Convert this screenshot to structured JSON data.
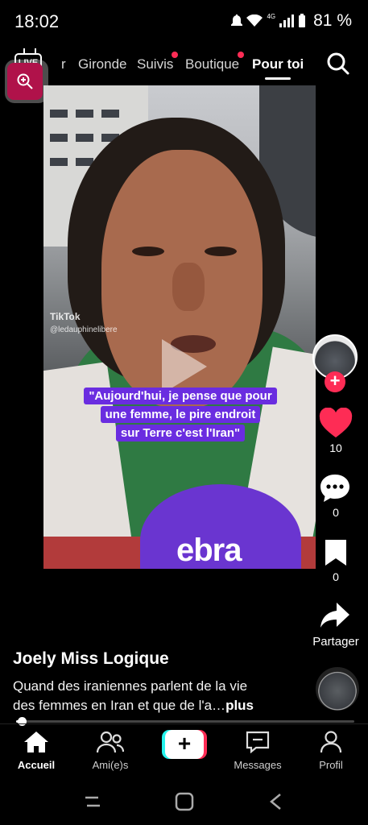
{
  "status_bar": {
    "time": "18:02",
    "network": "4G",
    "battery": "81 %"
  },
  "top_nav": {
    "live_label": "LIVE",
    "tabs": [
      {
        "label": "r",
        "active": false,
        "dot": false
      },
      {
        "label": "Gironde",
        "active": false,
        "dot": false
      },
      {
        "label": "Suivis",
        "active": false,
        "dot": true
      },
      {
        "label": "Boutique",
        "active": false,
        "dot": true
      },
      {
        "label": "Pour toi",
        "active": true,
        "dot": false
      }
    ]
  },
  "video": {
    "watermark_brand": "TikTok",
    "watermark_user": "@ledauphinelibere",
    "caption_lines": [
      "\"Aujourd'hui, je pense que pour",
      "une femme, le pire endroit",
      "sur Terre c'est l'Iran\""
    ],
    "mic_brand": "ebra"
  },
  "rail": {
    "likes": "10",
    "comments": "0",
    "saves": "0",
    "share_label": "Partager"
  },
  "post": {
    "author": "Joely Miss Logique",
    "description_line1": "Quand des iraniennes parlent de la vie",
    "description_line2": "des femmes en Iran et que de l'a…",
    "more_label": "plus",
    "progress": 0.01
  },
  "bottom_nav": {
    "items": [
      {
        "label": "Accueil",
        "active": true
      },
      {
        "label": "Ami(e)s",
        "active": false
      },
      {
        "label": "Messages",
        "active": false
      },
      {
        "label": "Profil",
        "active": false
      }
    ],
    "create_label": "+"
  },
  "colors": {
    "accent": "#fe2c55",
    "caption_bg": "#6a2de0",
    "mic": "#6a35d0"
  }
}
